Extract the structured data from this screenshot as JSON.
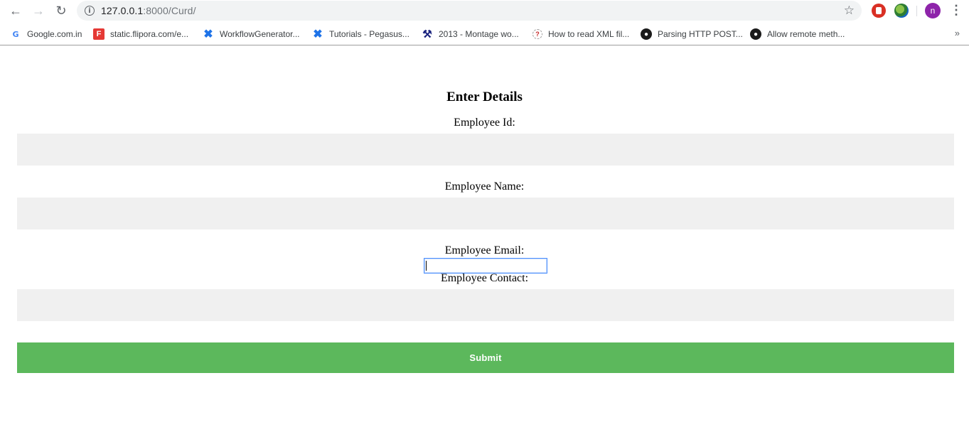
{
  "browser": {
    "url_host": "127.0.0.1",
    "url_rest": ":8000/Curd/",
    "avatar_letter": "n",
    "bookmarks": [
      {
        "label": "Google.com.in",
        "icon": "google-icon"
      },
      {
        "label": "static.flipora.com/e...",
        "icon": "flipora-icon"
      },
      {
        "label": "WorkflowGenerator...",
        "icon": "confluence-icon"
      },
      {
        "label": "Tutorials - Pegasus...",
        "icon": "confluence-icon"
      },
      {
        "label": "2013 - Montage wo...",
        "icon": "tools-icon"
      },
      {
        "label": "How to read XML fil...",
        "icon": "question-icon"
      },
      {
        "label": "Parsing HTTP POST...",
        "icon": "github-icon"
      },
      {
        "label": "Allow remote meth...",
        "icon": "github-icon"
      }
    ]
  },
  "form": {
    "title": "Enter Details",
    "fields": [
      {
        "label": "Employee Id:",
        "value": ""
      },
      {
        "label": "Employee Name:",
        "value": ""
      },
      {
        "label": "Employee Email:",
        "value": ""
      },
      {
        "label": "Employee Contact:",
        "value": ""
      }
    ],
    "submit_label": "Submit"
  },
  "colors": {
    "submit_bg": "#5cb85c",
    "input_bg": "#f0f0f0",
    "focus_border": "#4d90fe"
  }
}
